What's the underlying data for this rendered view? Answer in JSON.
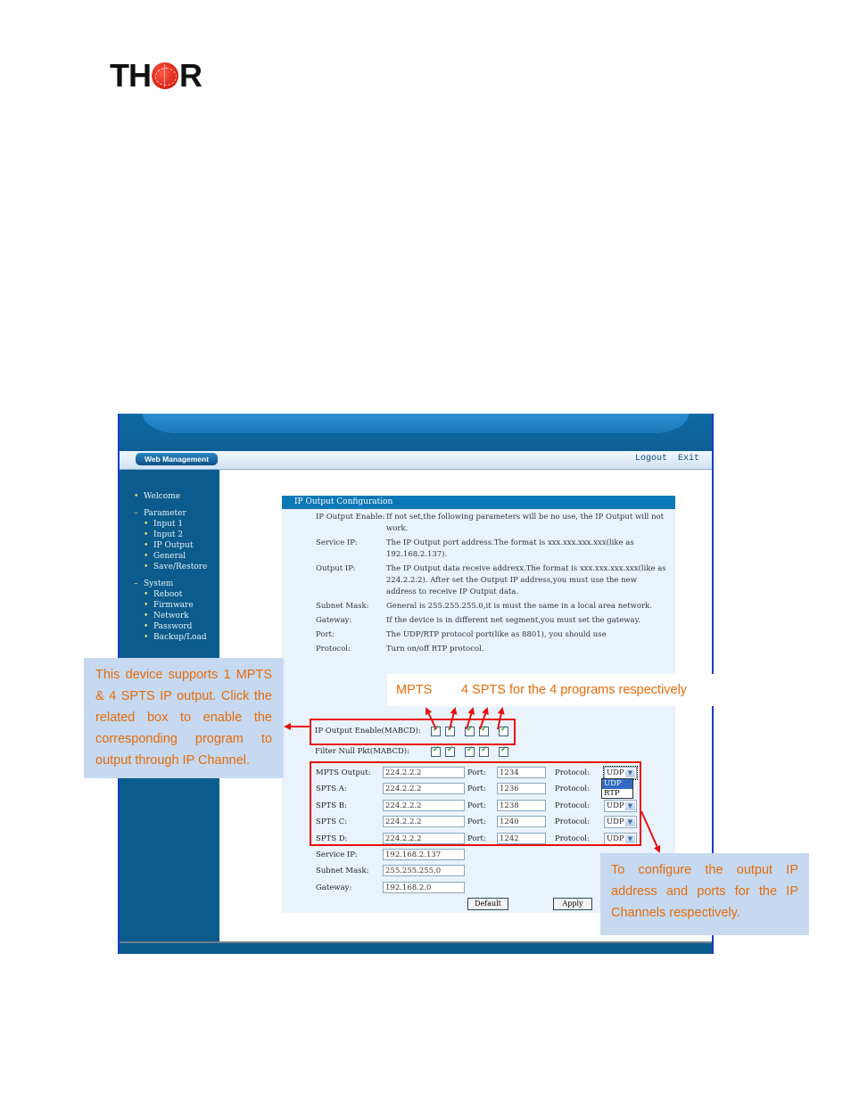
{
  "logo": {
    "text_left": "TH",
    "text_right": "R",
    "brand_color": "#d81e10"
  },
  "header": {
    "badge": "Web Management",
    "links": [
      "Logout",
      "Exit"
    ]
  },
  "sidebar": {
    "items": [
      {
        "label": "Welcome",
        "level": 0,
        "bullet": "•"
      },
      {
        "label": "Parameter",
        "level": 0,
        "bullet": "–"
      },
      {
        "label": "Input 1",
        "level": 1,
        "bullet": "•"
      },
      {
        "label": "Input 2",
        "level": 1,
        "bullet": "•"
      },
      {
        "label": "IP Output",
        "level": 1,
        "bullet": "•"
      },
      {
        "label": "General",
        "level": 1,
        "bullet": "•"
      },
      {
        "label": "Save/Restore",
        "level": 1,
        "bullet": "•"
      },
      {
        "label": "System",
        "level": 0,
        "bullet": "–"
      },
      {
        "label": "Reboot",
        "level": 1,
        "bullet": "•"
      },
      {
        "label": "Firmware",
        "level": 1,
        "bullet": "•"
      },
      {
        "label": "Network",
        "level": 1,
        "bullet": "•"
      },
      {
        "label": "Password",
        "level": 1,
        "bullet": "•"
      },
      {
        "label": "Backup/Load",
        "level": 1,
        "bullet": "•"
      }
    ]
  },
  "panel": {
    "title": "IP Output Configuration",
    "help": [
      {
        "label": "IP Output Enable:",
        "text": "If not set,the following parameters will be no use, the IP Output will not work."
      },
      {
        "label": "Service IP:",
        "text": "The IP Output port address.The format is xxx.xxx.xxx.xxx(like as 192.168.2.137)."
      },
      {
        "label": "Output IP:",
        "text": "The IP Output data receive addrexx.The format is xxx.xxx.xxx.xxx(like as 224.2.2.2). After set the Output IP address,you must use the new address to receive IP Output data."
      },
      {
        "label": "Subnet Mask:",
        "text": "General is 255.255.255.0,it is must the same in a local area network."
      },
      {
        "label": "Gateway:",
        "text": "If the device is in different net segment,you must set the gateway."
      },
      {
        "label": "Port:",
        "text": "The UDP/RTP protocol port(like as 8801), you should use"
      },
      {
        "label": "Protocol:",
        "text": "Turn on/off RTP protocol."
      }
    ],
    "ip_output_enable": {
      "label": "IP Output Enable(MABCD):",
      "checked": [
        true,
        true,
        true,
        true,
        true
      ]
    },
    "filter_null_pkt": {
      "label": "Filter Null Pkt(MABCD):",
      "checked": [
        true,
        true,
        true,
        true,
        true
      ]
    },
    "outputs": [
      {
        "label": "MPTS Output:",
        "ip": "224.2.2.2",
        "port_label": "Port:",
        "port": "1234",
        "protocol_label": "Protocol:",
        "protocol": "UDP"
      },
      {
        "label": "SPTS A:",
        "ip": "224.2.2.2",
        "port_label": "Port:",
        "port": "1236",
        "protocol_label": "Protocol:",
        "protocol": "UDP"
      },
      {
        "label": "SPTS B:",
        "ip": "224.2.2.2",
        "port_label": "Port:",
        "port": "1238",
        "protocol_label": "Protocol:",
        "protocol": "UDP"
      },
      {
        "label": "SPTS C:",
        "ip": "224.2.2.2",
        "port_label": "Port:",
        "port": "1240",
        "protocol_label": "Protocol:",
        "protocol": "UDP"
      },
      {
        "label": "SPTS D:",
        "ip": "224.2.2.2",
        "port_label": "Port:",
        "port": "1242",
        "protocol_label": "Protocol:",
        "protocol": "UDP"
      }
    ],
    "protocol_options": [
      "UDP",
      "RTP"
    ],
    "protocol_highlighted": "UDP",
    "service_ip": {
      "label": "Service IP:",
      "value": "192.168.2.137"
    },
    "subnet_mask": {
      "label": "Subnet Mask:",
      "value": "255.255.255.0"
    },
    "gateway": {
      "label": "Gateway:",
      "value": "192.168.2.0"
    },
    "buttons": {
      "default": "Default",
      "apply": "Apply"
    }
  },
  "annotations": {
    "left_note": "This device supports 1 MPTS & 4 SPTS IP output. Click the related box to enable the corresponding program to output through IP Channel.",
    "right_note": "To configure the output IP address and ports for the IP Channels respectively.",
    "mpts_label": "MPTS",
    "spts_label": "4 SPTS for the 4 programs respectively",
    "accent_color": "#e46c0a",
    "highlight_color": "#e81010"
  }
}
